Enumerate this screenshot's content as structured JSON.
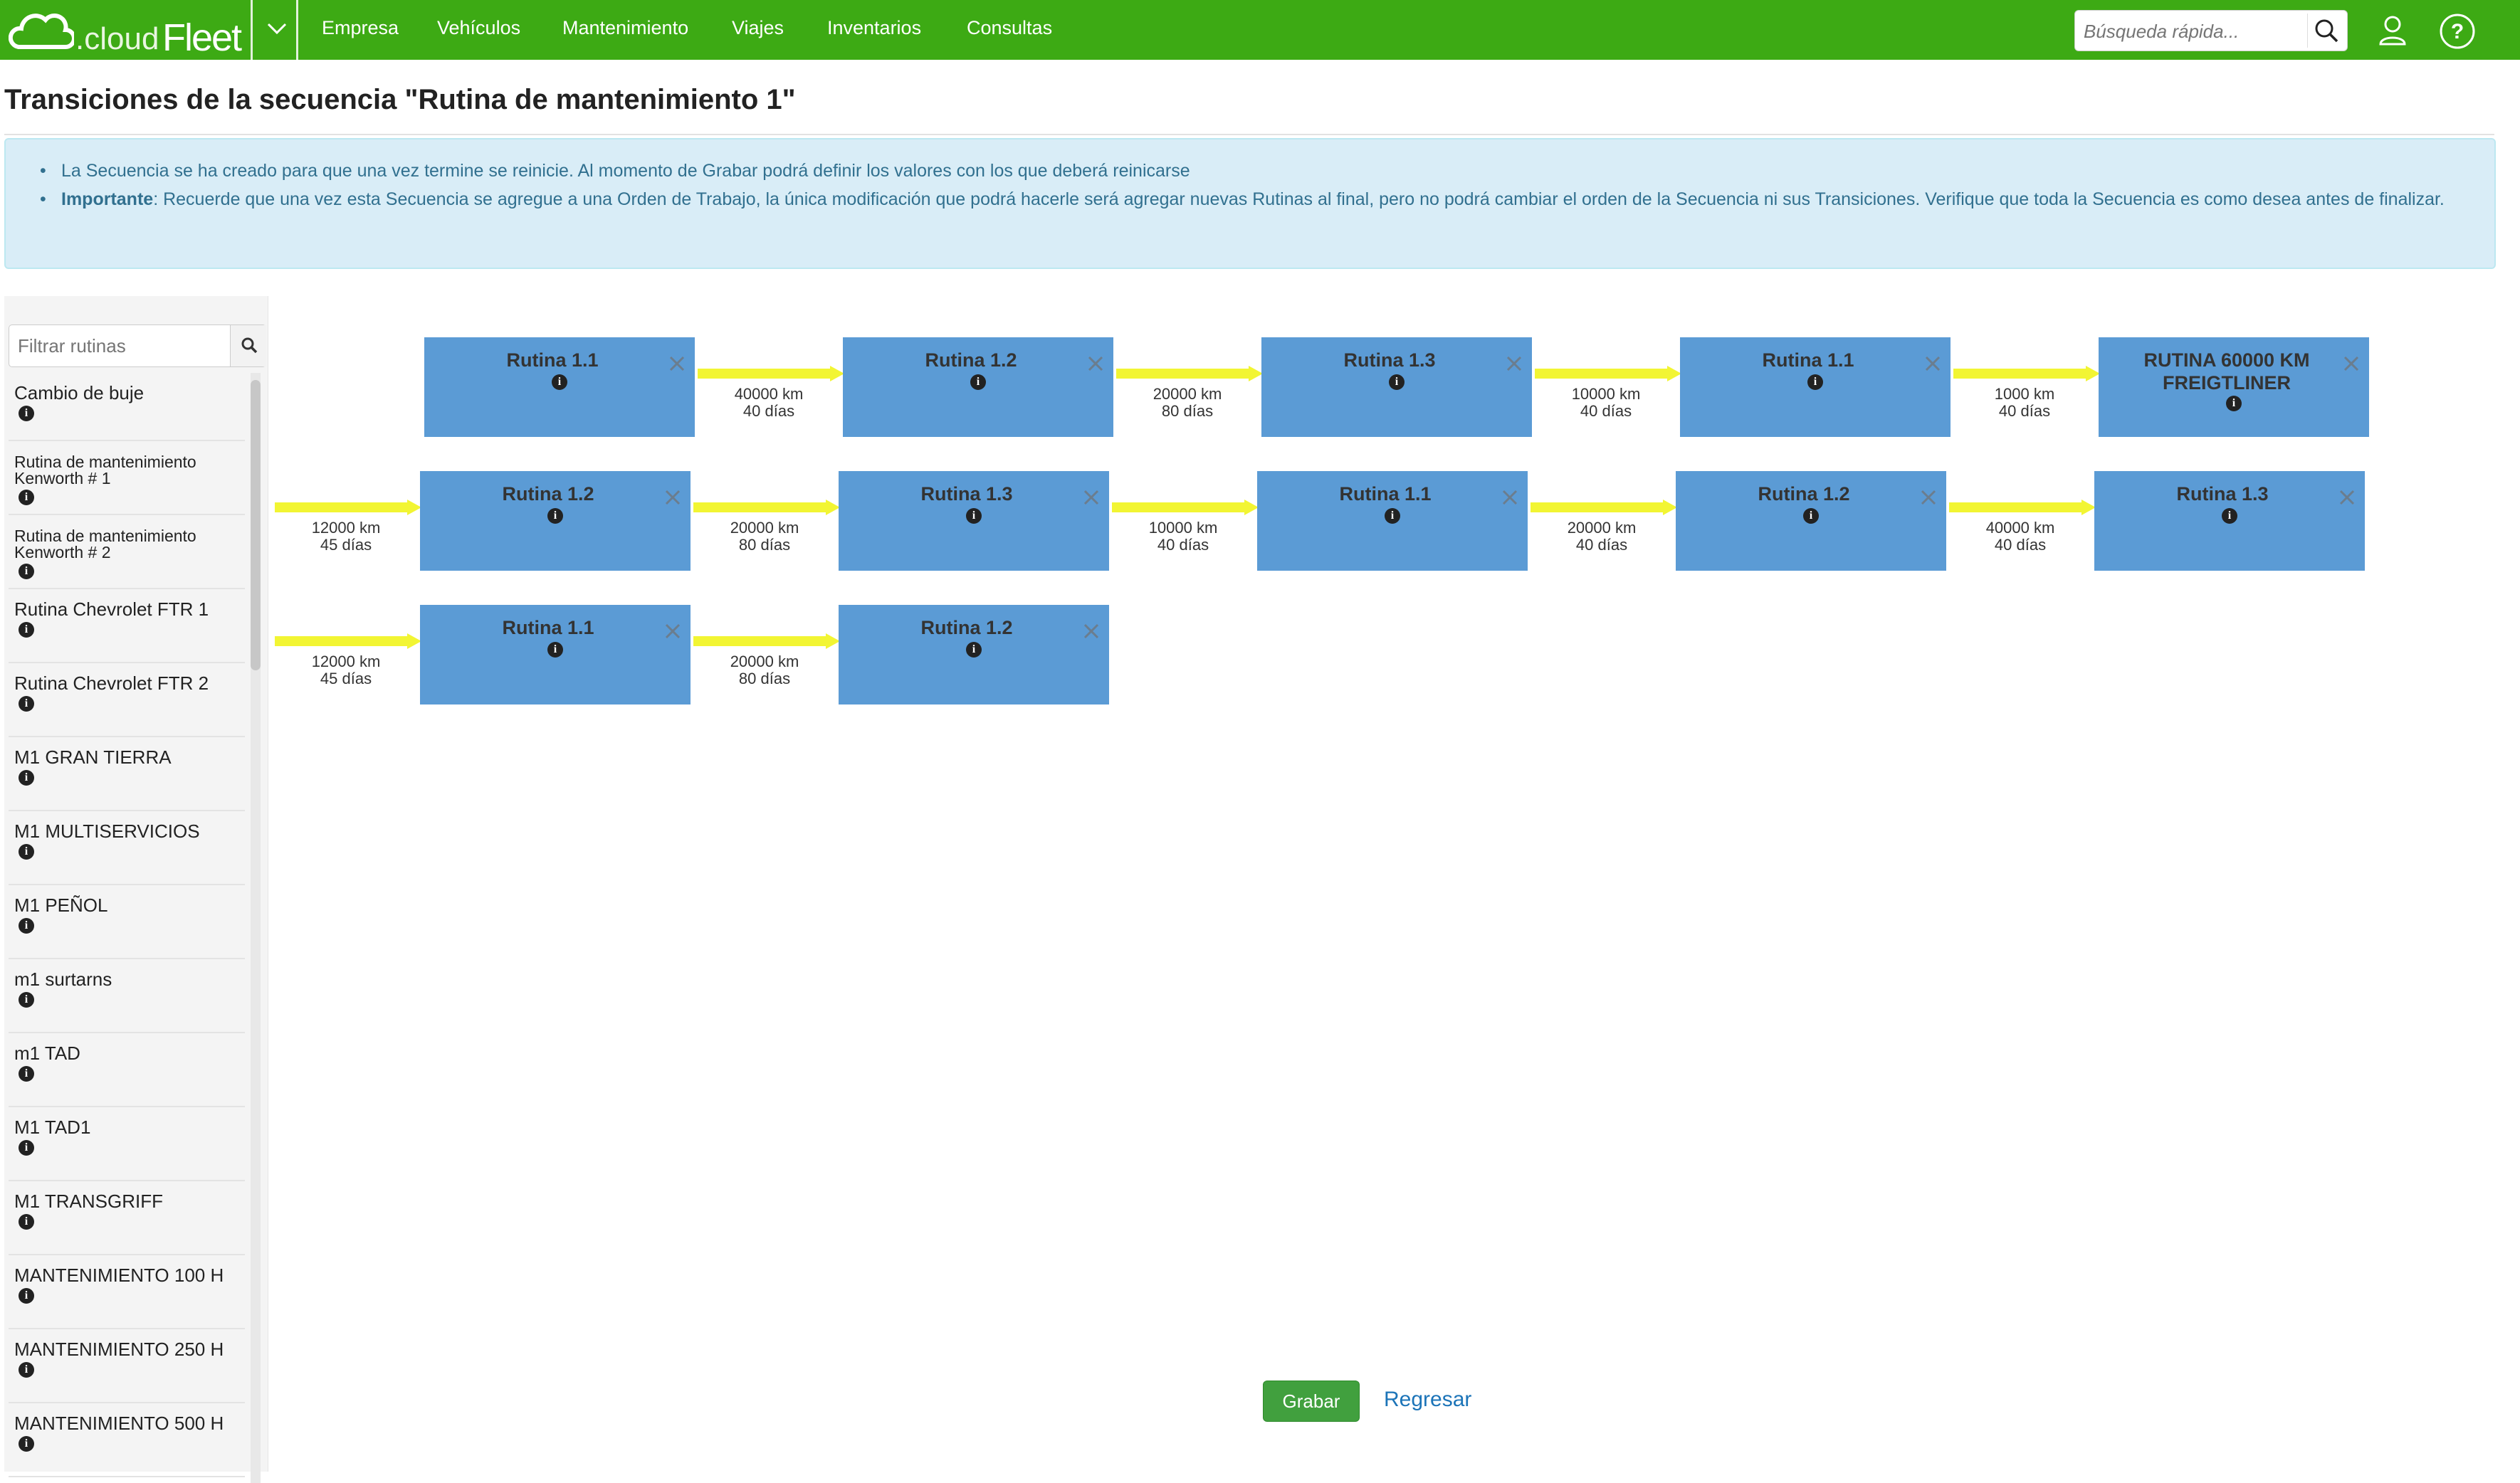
{
  "app": {
    "logo_text_light": ".cloud",
    "logo_text_bold": "Fleet",
    "nav": [
      "Empresa",
      "Vehículos",
      "Mantenimiento",
      "Viajes",
      "Inventarios",
      "Consultas"
    ],
    "search_placeholder": "Búsqueda rápida...",
    "brand_color": "#3daa14"
  },
  "page": {
    "title": "Transiciones de la secuencia \"Rutina de mantenimiento 1\"",
    "info": {
      "line1": "La Secuencia se ha creado para que una vez termine se reinicie. Al momento de Grabar podrá definir los valores con los que deberá reinicarse",
      "line2_bold": "Importante",
      "line2_rest": ": Recuerde que una vez esta Secuencia se agregue a una Orden de Trabajo, la única modificación que podrá hacerle será agregar nuevas Rutinas al final, pero no podrá cambiar el orden de la Secuencia ni sus Transiciones. Verifique que toda la Secuencia es como desea antes de finalizar."
    }
  },
  "sidebar": {
    "filter_placeholder": "Filtrar rutinas",
    "routines": [
      "Cambio de buje",
      "Rutina de mantenimiento Kenworth # 1",
      "Rutina de mantenimiento Kenworth # 2",
      "Rutina Chevrolet FTR 1",
      "Rutina Chevrolet FTR 2",
      "M1 GRAN TIERRA",
      "M1 MULTISERVICIOS",
      "M1 PEÑOL",
      "m1 surtarns",
      "m1 TAD",
      "M1 TAD1",
      "M1 TRANSGRIFF",
      "MANTENIMIENTO 100 H",
      "MANTENIMIENTO 250 H",
      "MANTENIMIENTO 500 H"
    ]
  },
  "sequence": {
    "rows": [
      [
        {
          "routine": "Rutina 1.1"
        },
        {
          "km": "40000 km",
          "days": "40 días"
        },
        {
          "routine": "Rutina 1.2"
        },
        {
          "km": "20000 km",
          "days": "80 días"
        },
        {
          "routine": "Rutina 1.3"
        },
        {
          "km": "10000 km",
          "days": "40 días"
        },
        {
          "routine": "Rutina 1.1"
        },
        {
          "km": "1000 km",
          "days": "40 días"
        },
        {
          "routine": "RUTINA 60000 KM FREIGTLINER"
        }
      ],
      [
        {
          "km": "12000 km",
          "days": "45 días"
        },
        {
          "routine": "Rutina 1.2"
        },
        {
          "km": "20000 km",
          "days": "80 días"
        },
        {
          "routine": "Rutina 1.3"
        },
        {
          "km": "10000 km",
          "days": "40 días"
        },
        {
          "routine": "Rutina 1.1"
        },
        {
          "km": "20000 km",
          "days": "40 días"
        },
        {
          "routine": "Rutina 1.2"
        },
        {
          "km": "40000 km",
          "days": "40 días"
        },
        {
          "routine": "Rutina 1.3"
        }
      ],
      [
        {
          "km": "12000 km",
          "days": "45 días"
        },
        {
          "routine": "Rutina 1.1"
        },
        {
          "km": "20000 km",
          "days": "80 días"
        },
        {
          "routine": "Rutina 1.2"
        }
      ]
    ],
    "node_color": "#5b9bd5",
    "arrow_color": "#f2f533"
  },
  "actions": {
    "save_label": "Grabar",
    "back_label": "Regresar"
  }
}
